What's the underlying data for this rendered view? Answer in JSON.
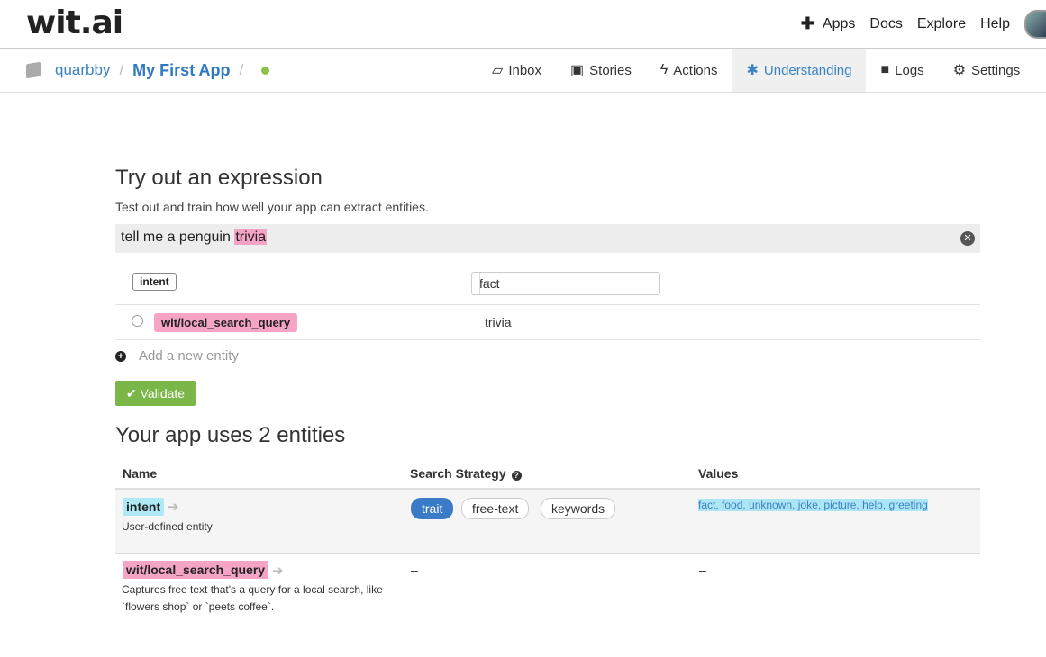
{
  "topbar": {
    "logo": "wit.ai",
    "nav": [
      "Apps",
      "Docs",
      "Explore",
      "Help"
    ]
  },
  "breadcrumb": {
    "owner": "quarbby",
    "app": "My First App"
  },
  "tabs": [
    {
      "label": "Inbox",
      "icon": "inbox-icon"
    },
    {
      "label": "Stories",
      "icon": "image-icon"
    },
    {
      "label": "Actions",
      "icon": "bolt-icon"
    },
    {
      "label": "Understanding",
      "icon": "asterisk-icon",
      "active": true
    },
    {
      "label": "Logs",
      "icon": "archive-icon"
    },
    {
      "label": "Settings",
      "icon": "gear-icon"
    }
  ],
  "try": {
    "title": "Try out an expression",
    "subtitle": "Test out and train how well your app can extract entities.",
    "expression_prefix": "tell me a penguin ",
    "expression_highlight": "trivia",
    "intent_tag": "intent",
    "intent_value": "fact",
    "entity_tag": "wit/local_search_query",
    "entity_value": "trivia",
    "add_entity": "Add a new entity",
    "validate": "Validate"
  },
  "entities": {
    "title": "Your app uses 2 entities",
    "headers": {
      "name": "Name",
      "strategy": "Search Strategy",
      "values": "Values"
    },
    "rows": [
      {
        "name": "intent",
        "desc": "User-defined entity",
        "strategies": [
          "trait",
          "free-text",
          "keywords"
        ],
        "values": "fact, food, unknown, joke, picture, help, greeting"
      },
      {
        "name": "wit/local_search_query",
        "desc1": "Captures free text that's a query for a local search, like",
        "desc2": "`flowers shop` or `peets coffee`.",
        "strategy": "–",
        "values": "–"
      }
    ]
  },
  "colors": {
    "accent": "#3b82c4",
    "validate": "#7ab648",
    "pink": "#f5a4c5",
    "cyan": "#aee9f5"
  }
}
